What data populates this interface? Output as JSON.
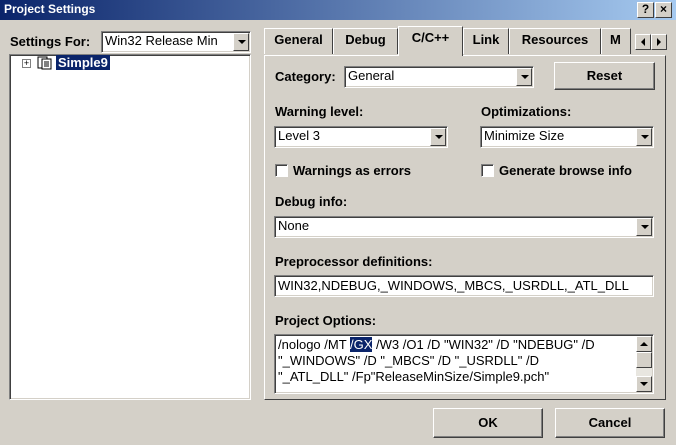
{
  "window": {
    "title": "Project Settings",
    "help_label": "?",
    "close_label": "×"
  },
  "left": {
    "settings_for_label": "Settings For:",
    "settings_for_value": "Win32 Release Min",
    "tree_item": "Simple9",
    "tree_expand": "+"
  },
  "tabs": [
    "General",
    "Debug",
    "C/C++",
    "Link",
    "Resources",
    "M"
  ],
  "active_tab": "C/C++",
  "category": {
    "label": "Category:",
    "value": "General",
    "reset_label": "Reset"
  },
  "warning_level": {
    "label": "Warning level:",
    "value": "Level 3"
  },
  "optimizations": {
    "label": "Optimizations:",
    "value": "Minimize Size"
  },
  "checkboxes": {
    "warnings_as_errors": "Warnings as errors",
    "generate_browse_info": "Generate browse info"
  },
  "debug_info": {
    "label": "Debug info:",
    "value": "None"
  },
  "preprocessor": {
    "label": "Preprocessor definitions:",
    "value": "WIN32,NDEBUG,_WINDOWS,_MBCS,_USRDLL,_ATL_DLL"
  },
  "project_options": {
    "label": "Project Options:",
    "line1_pre": "/nologo /MT ",
    "line1_sel": "/GX",
    "line1_post": " /W3 /O1 /D \"WIN32\" /D \"NDEBUG\" /D",
    "line2": "\"_WINDOWS\" /D \"_MBCS\" /D \"_USRDLL\" /D",
    "line3": "\"_ATL_DLL\" /Fp\"ReleaseMinSize/Simple9.pch\""
  },
  "buttons": {
    "ok": "OK",
    "cancel": "Cancel"
  }
}
